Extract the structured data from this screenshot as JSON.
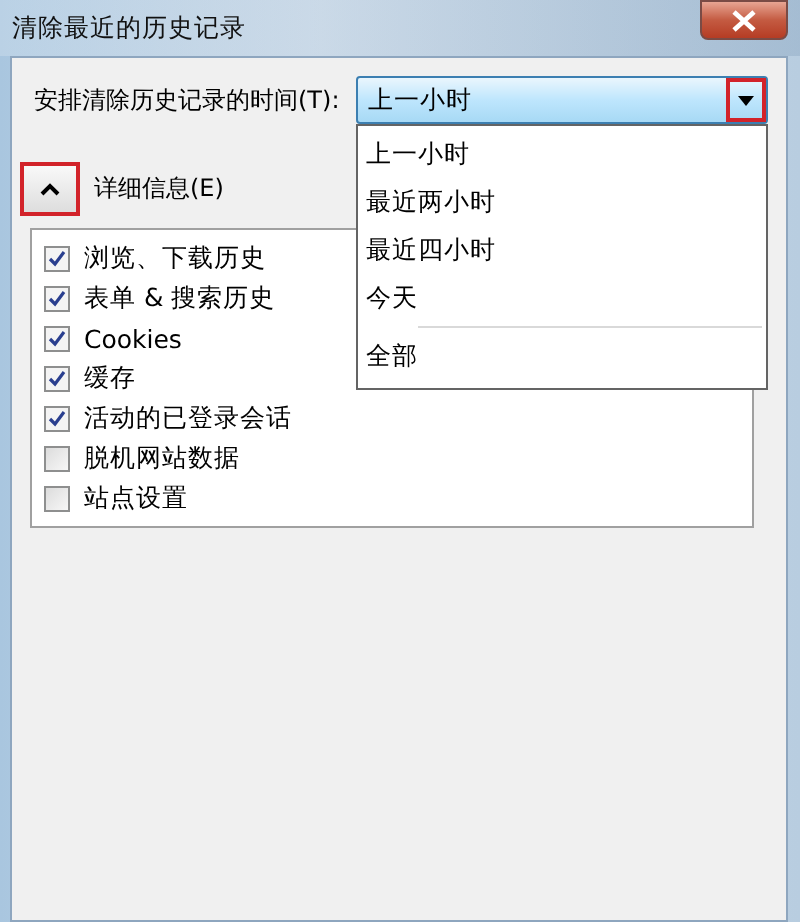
{
  "window": {
    "title": "清除最近的历史记录"
  },
  "time_range": {
    "label": "安排清除历史记录的时间(T):",
    "value": "上一小时",
    "button_highlighted": true,
    "expanded": true,
    "options": [
      {
        "label": "上一小时",
        "separator_before": false
      },
      {
        "label": "最近两小时",
        "separator_before": false
      },
      {
        "label": "最近四小时",
        "separator_before": false
      },
      {
        "label": "今天",
        "separator_before": false
      },
      {
        "label": "全部",
        "separator_before": true
      }
    ]
  },
  "details": {
    "label": "详细信息(E)",
    "expanded": true,
    "button_highlighted": true
  },
  "items": [
    {
      "label": "浏览、下载历史",
      "checked": true
    },
    {
      "label": "表单 & 搜索历史",
      "checked": true
    },
    {
      "label": "Cookies",
      "checked": true
    },
    {
      "label": "缓存",
      "checked": true
    },
    {
      "label": "活动的已登录会话",
      "checked": true
    },
    {
      "label": "脱机网站数据",
      "checked": false
    },
    {
      "label": "站点设置",
      "checked": false
    }
  ]
}
